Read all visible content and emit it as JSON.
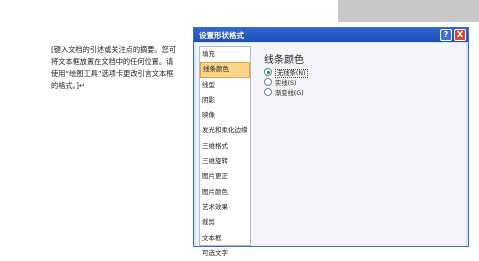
{
  "document": {
    "text": "[键入文档的引述或关注点的摘要。您可将文本框放置在文档中的任何位置。请使用“绘图工具”选项卡更改引言文本框的格式。]↵"
  },
  "dialog": {
    "title": "设置形状格式",
    "help_label": "?",
    "close_label": "X",
    "nav_items": [
      "填充",
      "线条颜色",
      "线型",
      "阴影",
      "映像",
      "发光和柔化边缘",
      "三维格式",
      "三维旋转",
      "图片更正",
      "图片颜色",
      "艺术效果",
      "裁剪",
      "文本框",
      "可选文字"
    ],
    "selected_index": 1,
    "section_title": "线条颜色",
    "options": [
      {
        "label": "无线条(N)",
        "checked": true
      },
      {
        "label": "实线(S)",
        "checked": false
      },
      {
        "label": "渐变线(G)",
        "checked": false
      }
    ]
  }
}
